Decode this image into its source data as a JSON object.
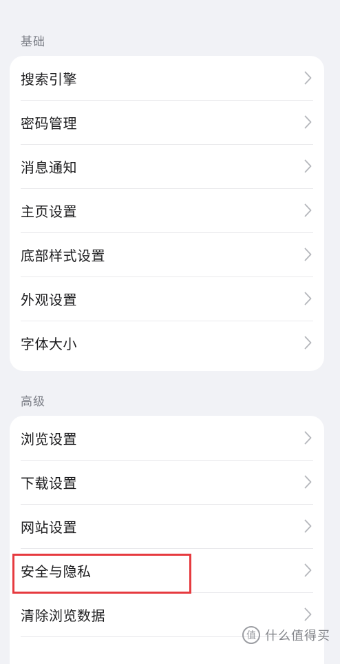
{
  "sections": {
    "basic": {
      "title": "基础",
      "items": [
        "搜索引擎",
        "密码管理",
        "消息通知",
        "主页设置",
        "底部样式设置",
        "外观设置",
        "字体大小"
      ]
    },
    "advanced": {
      "title": "高级",
      "items": [
        "浏览设置",
        "下载设置",
        "网站设置",
        "安全与隐私",
        "清除浏览数据"
      ]
    }
  },
  "highlight_color": "#e63a3f",
  "chevron_icon": "chevron-right-icon",
  "watermark": {
    "text": "什么值得买",
    "logo_icon": "smzdm-logo-icon"
  }
}
